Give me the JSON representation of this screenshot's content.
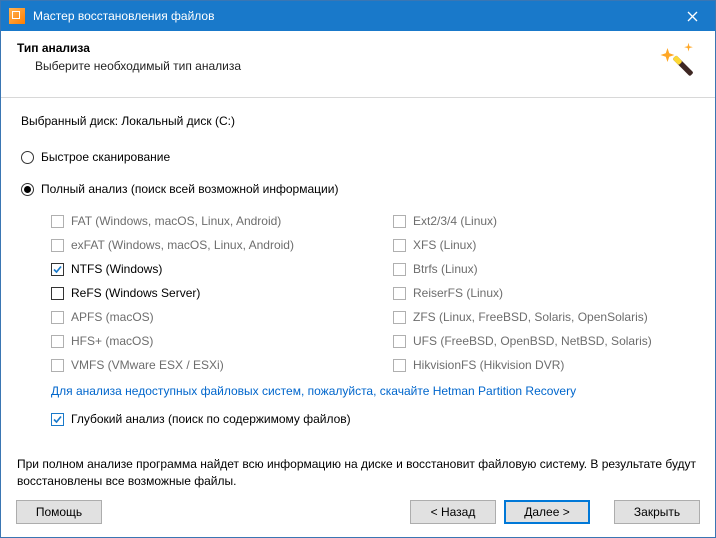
{
  "titlebar": {
    "title": "Мастер восстановления файлов"
  },
  "header": {
    "title": "Тип анализа",
    "subtitle": "Выберите необходимый тип анализа"
  },
  "selected_disk": "Выбранный диск: Локальный диск (C:)",
  "scan": {
    "quick_label": "Быстрое сканирование",
    "full_label": "Полный анализ (поиск всей возможной информации)",
    "selected": "full"
  },
  "filesystems": {
    "left": [
      {
        "id": "fat",
        "label": "FAT (Windows, macOS, Linux, Android)",
        "checked": false,
        "enabled": false
      },
      {
        "id": "exfat",
        "label": "exFAT (Windows, macOS, Linux, Android)",
        "checked": false,
        "enabled": false
      },
      {
        "id": "ntfs",
        "label": "NTFS (Windows)",
        "checked": true,
        "enabled": true
      },
      {
        "id": "refs",
        "label": "ReFS (Windows Server)",
        "checked": false,
        "enabled": true
      },
      {
        "id": "apfs",
        "label": "APFS (macOS)",
        "checked": false,
        "enabled": false
      },
      {
        "id": "hfs",
        "label": "HFS+ (macOS)",
        "checked": false,
        "enabled": false
      },
      {
        "id": "vmfs",
        "label": "VMFS (VMware ESX / ESXi)",
        "checked": false,
        "enabled": false
      }
    ],
    "right": [
      {
        "id": "ext",
        "label": "Ext2/3/4 (Linux)",
        "checked": false,
        "enabled": false
      },
      {
        "id": "xfs",
        "label": "XFS (Linux)",
        "checked": false,
        "enabled": false
      },
      {
        "id": "btrfs",
        "label": "Btrfs (Linux)",
        "checked": false,
        "enabled": false
      },
      {
        "id": "reiser",
        "label": "ReiserFS (Linux)",
        "checked": false,
        "enabled": false
      },
      {
        "id": "zfs",
        "label": "ZFS (Linux, FreeBSD, Solaris, OpenSolaris)",
        "checked": false,
        "enabled": false
      },
      {
        "id": "ufs",
        "label": "UFS (FreeBSD, OpenBSD, NetBSD, Solaris)",
        "checked": false,
        "enabled": false
      },
      {
        "id": "hikfs",
        "label": "HikvisionFS (Hikvision DVR)",
        "checked": false,
        "enabled": false
      }
    ]
  },
  "promo_link": "Для анализа недоступных файловых систем, пожалуйста, скачайте Hetman Partition Recovery",
  "deep": {
    "label": "Глубокий анализ (поиск по содержимому файлов)",
    "checked": true
  },
  "description": "При полном анализе программа найдет всю информацию на диске и восстановит файловую систему. В результате будут восстановлены все возможные файлы.",
  "buttons": {
    "help": "Помощь",
    "back": "< Назад",
    "next": "Далее >",
    "close": "Закрыть"
  }
}
